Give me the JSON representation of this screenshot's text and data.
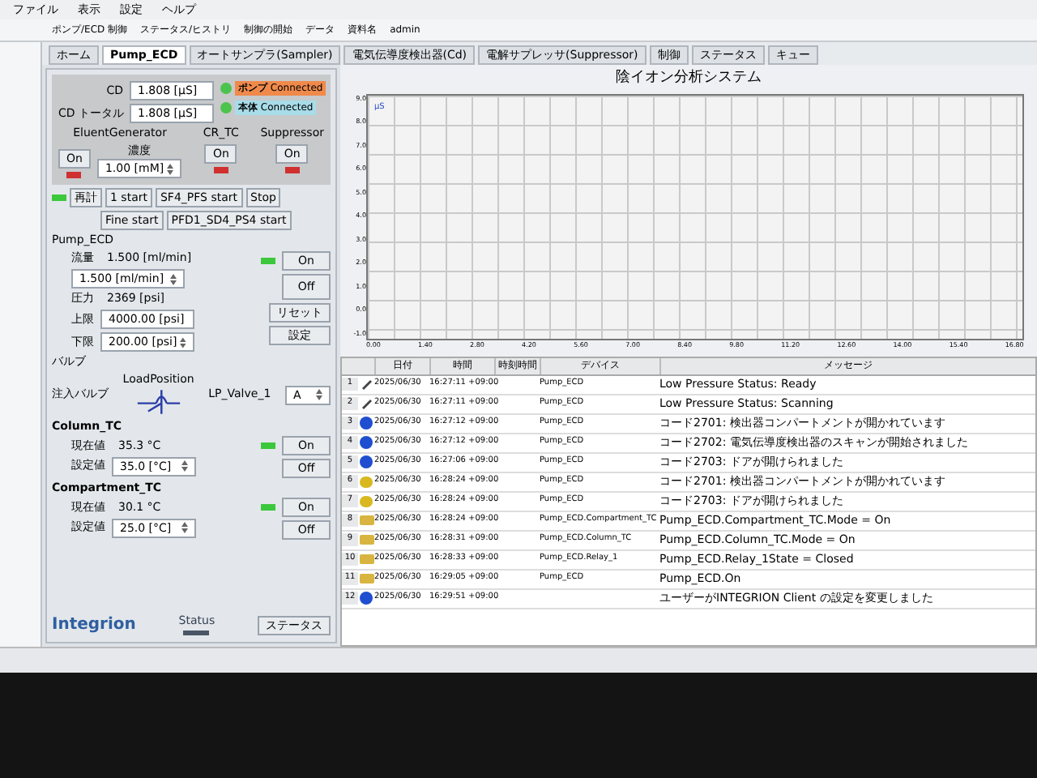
{
  "menu": [
    "ファイル",
    "表示",
    "設定",
    "ヘルプ"
  ],
  "toolbar": [
    "ポンプ/ECD 制御",
    "ステータス/ヒストリ",
    "制御の開始",
    "データ",
    "資料名",
    "admin"
  ],
  "tabs": [
    {
      "label": "ホーム",
      "selected": false
    },
    {
      "label": "Pump_ECD",
      "selected": true
    },
    {
      "label": "オートサンプラ(Sampler)",
      "selected": false
    },
    {
      "label": "電気伝導度検出器(Cd)",
      "selected": false
    },
    {
      "label": "電解サプレッサ(Suppressor)",
      "selected": false
    },
    {
      "label": "制御",
      "selected": false
    },
    {
      "label": "ステータス",
      "selected": false
    },
    {
      "label": "キュー",
      "selected": false
    }
  ],
  "detector": {
    "readings": [
      {
        "label": "CD",
        "value": "1.808 [µS]"
      },
      {
        "label": "CD トータル",
        "value": "1.808 [µS]"
      }
    ],
    "connections": [
      {
        "label": "ポンプ",
        "status": "Connected",
        "color": "#f08a4b"
      },
      {
        "label": "本体",
        "status": "Connected",
        "color": "#a8dce8"
      }
    ],
    "devices": [
      {
        "name": "EluentGenerator",
        "button": "On",
        "on": false,
        "extra_label": "濃度",
        "extra_value": "1.00 [mM]"
      },
      {
        "name": "CR_TC",
        "button": "On",
        "on": false
      },
      {
        "name": "Suppressor",
        "button": "On",
        "on": false
      }
    ]
  },
  "actions": {
    "ready": true,
    "buttons": [
      "再計",
      "1 start",
      "SF4_PFS start",
      "Stop",
      "Fine start",
      "PFD1_SD4_PS4 start"
    ]
  },
  "pump": {
    "title": "Pump_ECD",
    "flow_label": "流量",
    "flow": "1.500 [ml/min]",
    "flow_set": "1.500 [ml/min]",
    "on": true,
    "on_button": "On",
    "off_button": "Off",
    "pressure_label": "圧力",
    "pressure": "2369 [psi]",
    "reset_button": "リセット",
    "upper_label": "上限",
    "upper": "4000.00 [psi]",
    "lower_label": "下限",
    "lower": "200.00 [psi]",
    "set_button": "設定"
  },
  "valve": {
    "title": "バルブ",
    "position": "LoadPosition",
    "label": "注入バルブ",
    "selector_label": "LP_Valve_1",
    "selector_value": "A"
  },
  "ovens": [
    {
      "title": "Column_TC",
      "current_label": "現在値",
      "current": "35.3 °C",
      "set_label": "設定値",
      "set": "35.0 [°C]",
      "on": true,
      "on_button": "On",
      "off_button": "Off"
    },
    {
      "title": "Compartment_TC",
      "current_label": "現在値",
      "current": "30.1 °C",
      "set_label": "設定値",
      "set": "25.0 [°C]",
      "on": true,
      "on_button": "On",
      "off_button": "Off"
    }
  ],
  "brand": "Integrion",
  "brand_caption": "Status",
  "status_button": "ステータス",
  "chart": {
    "title": "陰イオン分析システム",
    "legend": "µS",
    "y_ticks": [
      "9.0",
      "8.0",
      "7.0",
      "6.0",
      "5.0",
      "4.0",
      "3.0",
      "2.0",
      "1.0",
      "0.0",
      "-1.0"
    ],
    "x_ticks": [
      "0.00",
      "1.40",
      "2.80",
      "4.20",
      "5.60",
      "7.00",
      "8.40",
      "9.80",
      "11.20",
      "12.60",
      "14.00",
      "15.40",
      "16.80"
    ]
  },
  "log": {
    "columns": [
      "日付",
      "時間",
      "時刻時間",
      "デバイス",
      "メッセージ"
    ],
    "rows": [
      {
        "no": "1",
        "kind": "edit",
        "date": "2025/06/30",
        "time": "16:27:11 +09:00",
        "device": "Pump_ECD",
        "message": "Low Pressure Status: Ready"
      },
      {
        "no": "2",
        "kind": "edit",
        "date": "2025/06/30",
        "time": "16:27:11 +09:00",
        "device": "Pump_ECD",
        "message": "Low Pressure Status: Scanning"
      },
      {
        "no": "3",
        "kind": "info",
        "date": "2025/06/30",
        "time": "16:27:12 +09:00",
        "device": "Pump_ECD",
        "message": "コード2701: 検出器コンパートメントが開かれています"
      },
      {
        "no": "4",
        "kind": "info",
        "date": "2025/06/30",
        "time": "16:27:12 +09:00",
        "device": "Pump_ECD",
        "message": "コード2702: 電気伝導度検出器のスキャンが開始されました"
      },
      {
        "no": "5",
        "kind": "info",
        "date": "2025/06/30",
        "time": "16:27:06 +09:00",
        "device": "Pump_ECD",
        "message": "コード2703: ドアが開けられました"
      },
      {
        "no": "6",
        "kind": "warning",
        "date": "2025/06/30",
        "time": "16:28:24 +09:00",
        "device": "Pump_ECD",
        "message": "コード2701: 検出器コンパートメントが開かれています"
      },
      {
        "no": "7",
        "kind": "warning",
        "date": "2025/06/30",
        "time": "16:28:24 +09:00",
        "device": "Pump_ECD",
        "message": "コード2703: ドアが開けられました"
      },
      {
        "no": "8",
        "kind": "folder",
        "date": "2025/06/30",
        "time": "16:28:24 +09:00",
        "device": "Pump_ECD.Compartment_TC",
        "message": "Pump_ECD.Compartment_TC.Mode = On"
      },
      {
        "no": "9",
        "kind": "folder",
        "date": "2025/06/30",
        "time": "16:28:31 +09:00",
        "device": "Pump_ECD.Column_TC",
        "message": "Pump_ECD.Column_TC.Mode = On"
      },
      {
        "no": "10",
        "kind": "folder",
        "date": "2025/06/30",
        "time": "16:28:33 +09:00",
        "device": "Pump_ECD.Relay_1",
        "message": "Pump_ECD.Relay_1State = Closed"
      },
      {
        "no": "11",
        "kind": "folder",
        "date": "2025/06/30",
        "time": "16:29:05 +09:00",
        "device": "Pump_ECD",
        "message": "Pump_ECD.On"
      },
      {
        "no": "12",
        "kind": "info",
        "date": "2025/06/30",
        "time": "16:29:51 +09:00",
        "device": "",
        "message": "ユーザーがINTEGRION Client の設定を変更しました"
      }
    ]
  }
}
